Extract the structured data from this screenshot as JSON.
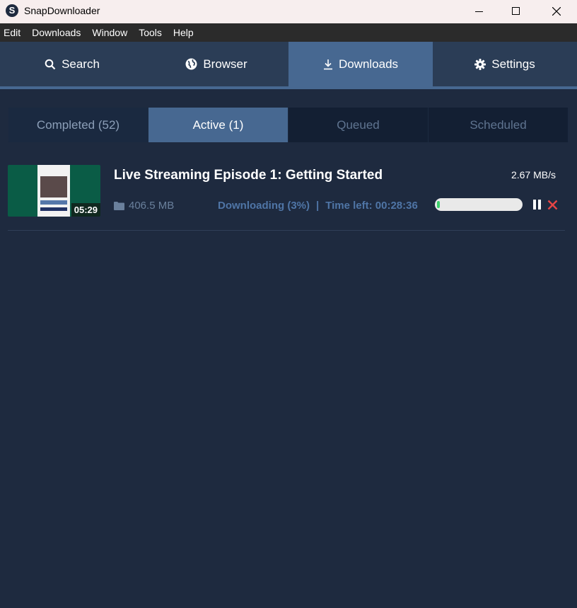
{
  "window": {
    "title": "SnapDownloader",
    "logo_letter": "S"
  },
  "menu": [
    "Edit",
    "Downloads",
    "Window",
    "Tools",
    "Help"
  ],
  "main_tabs": [
    {
      "label": "Search",
      "icon": "search-icon"
    },
    {
      "label": "Browser",
      "icon": "globe-icon"
    },
    {
      "label": "Downloads",
      "icon": "download-icon",
      "active": true
    },
    {
      "label": "Settings",
      "icon": "gear-icon"
    }
  ],
  "sub_tabs": [
    {
      "label": "Completed (52)"
    },
    {
      "label": "Active (1)",
      "active": true
    },
    {
      "label": "Queued"
    },
    {
      "label": "Scheduled"
    }
  ],
  "download": {
    "title": "Live Streaming Episode 1: Getting Started",
    "duration": "05:29",
    "speed": "2.67 MB/s",
    "size": "406.5 MB",
    "status": "Downloading (3%)",
    "separator": "|",
    "time_left": "Time left: 00:28:36",
    "progress": 0.03
  },
  "colors": {
    "background": "#1e2a3f",
    "active_tab": "#476891",
    "progress_fill": "#3cd06b",
    "cancel": "#e84545",
    "status_text": "#4f75a6"
  }
}
